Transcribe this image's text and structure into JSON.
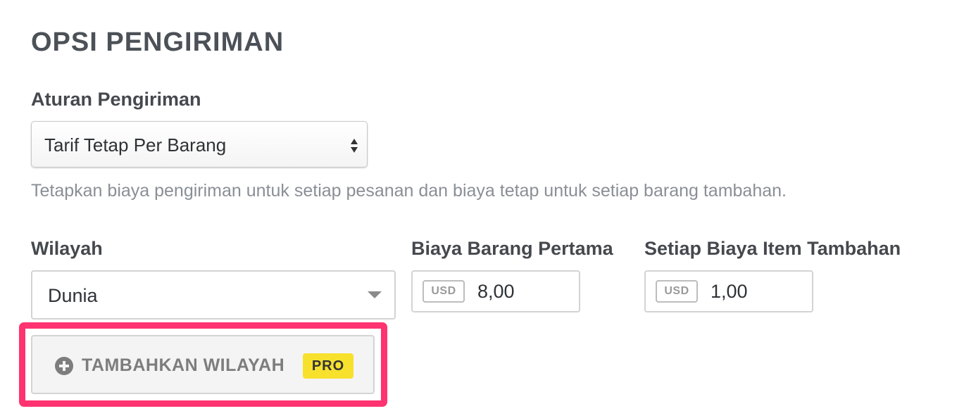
{
  "section": {
    "title": "OPSI PENGIRIMAN"
  },
  "shipping_rule": {
    "label": "Aturan Pengiriman",
    "selected": "Tarif Tetap Per Barang",
    "help": "Tetapkan biaya pengiriman untuk setiap pesanan dan biaya tetap untuk setiap barang tambahan."
  },
  "region": {
    "label": "Wilayah",
    "selected": "Dunia"
  },
  "first_item_cost": {
    "label": "Biaya Barang Pertama",
    "currency": "USD",
    "value": "8,00"
  },
  "additional_item_cost": {
    "label": "Setiap Biaya Item Tambahan",
    "currency": "USD",
    "value": "1,00"
  },
  "add_region": {
    "label": "TAMBAHKAN WILAYAH",
    "badge": "PRO",
    "icon": "plus-circle-icon"
  },
  "colors": {
    "highlight": "#fe3370",
    "pro_badge": "#f7e12d"
  }
}
